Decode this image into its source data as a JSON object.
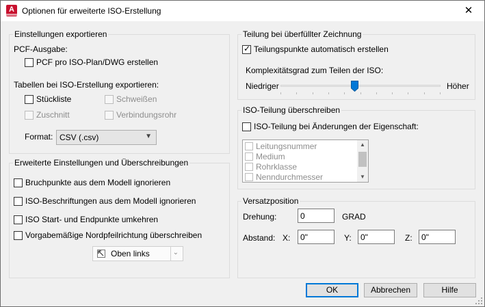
{
  "window": {
    "title": "Optionen für erweiterte ISO-Erstellung",
    "app_icon_letter": "A",
    "close_glyph": "✕"
  },
  "export_settings": {
    "legend": "Einstellungen exportieren",
    "pcf_output_label": "PCF-Ausgabe:",
    "pcf_per_plan": {
      "label": "PCF pro ISO-Plan/DWG erstellen",
      "checked": false
    },
    "tables_label": "Tabellen bei ISO-Erstellung exportieren:",
    "bom": {
      "label": "Stückliste",
      "checked": false,
      "enabled": true
    },
    "welds": {
      "label": "Schweißen",
      "checked": false,
      "enabled": false
    },
    "cut": {
      "label": "Zuschnitt",
      "checked": false,
      "enabled": false
    },
    "connection_pipe": {
      "label": "Verbindungsrohr",
      "checked": false,
      "enabled": false
    },
    "format_label": "Format:",
    "format_value": "CSV (.csv)"
  },
  "advanced": {
    "legend": "Erweiterte Einstellungen und Überschreibungen",
    "items": [
      {
        "label": "Bruchpunkte aus dem Modell ignorieren",
        "checked": false
      },
      {
        "label": "ISO-Beschriftungen aus dem Modell ignorieren",
        "checked": false
      },
      {
        "label": "ISO Start- und Endpunkte umkehren",
        "checked": false
      },
      {
        "label": "Vorgabemäßige Nordpfeilrichtung überschreiben",
        "checked": false
      }
    ],
    "north_position": "Oben links",
    "north_icon": "north-arrow-top-left-icon"
  },
  "split": {
    "legend": "Teilung bei überfüllter Zeichnung",
    "auto_split": {
      "label": "Teilungspunkte automatisch erstellen",
      "checked": true
    },
    "complexity_label": "Komplexitätsgrad zum Teilen der ISO:",
    "low_label": "Niedriger",
    "high_label": "Höher",
    "slider_level_fraction": 0.46
  },
  "iso_override": {
    "legend": "ISO-Teilung überschreiben",
    "on_change": {
      "label": "ISO-Teilung bei Änderungen der Eigenschaft:",
      "checked": false
    },
    "properties": [
      "Leitungsnummer",
      "Medium",
      "Rohrklasse",
      "Nenndurchmesser"
    ]
  },
  "offset": {
    "legend": "Versatzposition",
    "rotation_label": "Drehung:",
    "rotation_value": "0",
    "rotation_unit": "GRAD",
    "distance_label": "Abstand:",
    "x_label": "X:",
    "x_value": "0\"",
    "y_label": "Y:",
    "y_value": "0\"",
    "z_label": "Z:",
    "z_value": "0\""
  },
  "buttons": {
    "ok": "OK",
    "cancel": "Abbrechen",
    "help": "Hilfe"
  },
  "colors": {
    "accent": "#0078d7",
    "slider_thumb": "#0078d7",
    "app_icon": "#c8102e"
  }
}
